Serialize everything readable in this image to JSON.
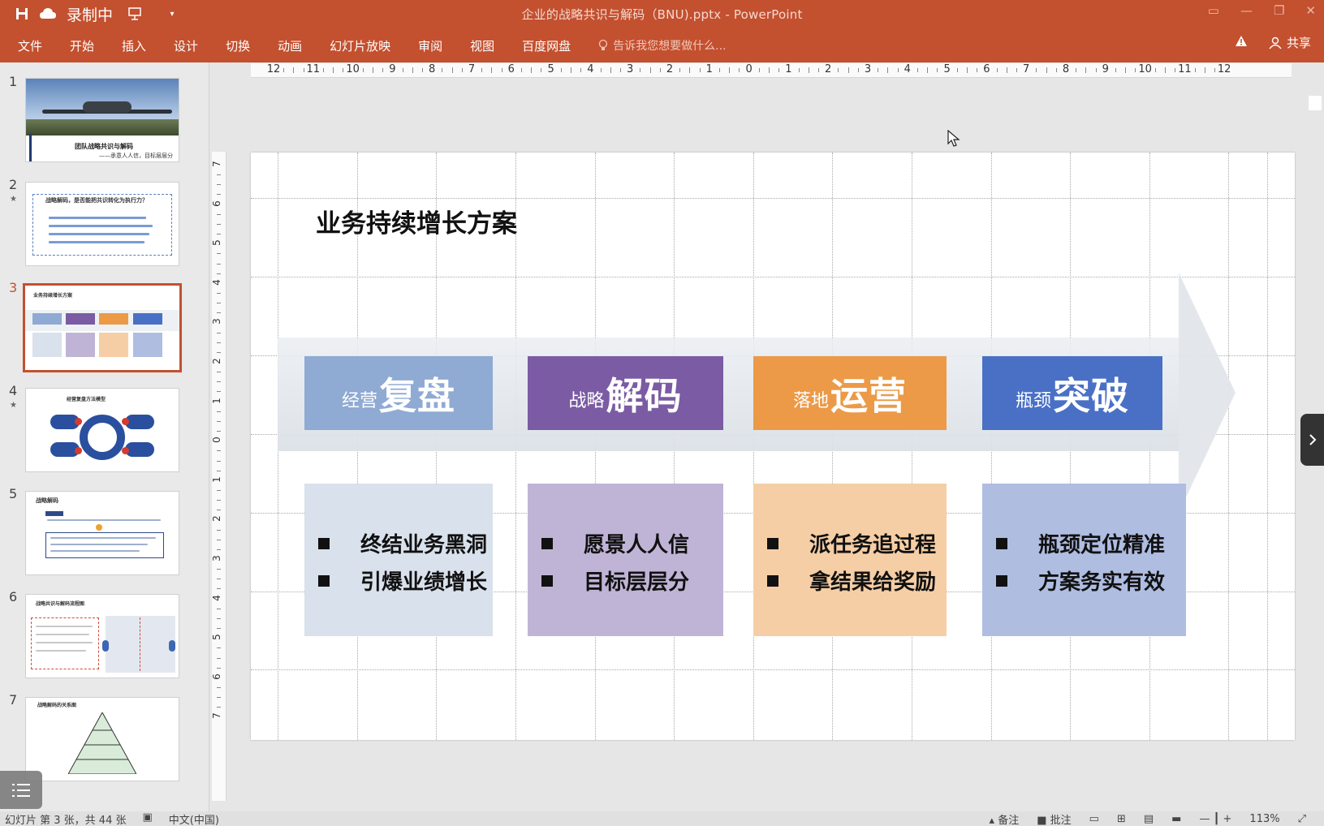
{
  "window": {
    "title": "企业的战略共识与解码（BNU).pptx - PowerPoint",
    "recording_label": "录制中"
  },
  "ribbon": {
    "tabs": [
      "文件",
      "开始",
      "插入",
      "设计",
      "切换",
      "动画",
      "幻灯片放映",
      "审阅",
      "视图",
      "百度网盘"
    ],
    "tell_me_placeholder": "告诉我您想要做什么...",
    "share_label": "共享"
  },
  "ruler": {
    "horizontal": [
      "12",
      "11",
      "10",
      "9",
      "8",
      "7",
      "6",
      "5",
      "4",
      "3",
      "2",
      "1",
      "0",
      "1",
      "2",
      "3",
      "4",
      "5",
      "6",
      "7",
      "8",
      "9",
      "10",
      "11",
      "12"
    ],
    "vertical": [
      "7",
      "6",
      "5",
      "4",
      "3",
      "2",
      "1",
      "0",
      "1",
      "2",
      "3",
      "4",
      "5",
      "6",
      "7"
    ]
  },
  "thumbnails": {
    "numbers": [
      "1",
      "2",
      "3",
      "4",
      "5",
      "6",
      "7"
    ],
    "active_index": 3,
    "slide1": {
      "title": "团队战略共识与解码",
      "subtitle": "——承意人人信，目标层层分"
    },
    "slide2": {
      "title": "战略解码，是否能把共识转化为执行力？"
    },
    "slide3": {
      "title": "业务持续增长方案",
      "heads": [
        "经营复盘",
        "战略解码",
        "落地运营",
        "瓶颈突破"
      ]
    },
    "slide4": {
      "title": "经营复盘方法模型"
    },
    "slide5": {
      "title": "战略解码"
    },
    "slide6": {
      "title": "战略共识与解码流程图"
    },
    "slide7": {
      "title": "战略解码的关系图"
    }
  },
  "slide": {
    "title": "业务持续增长方案",
    "columns": [
      {
        "small": "经营",
        "big": "复盘",
        "lines": [
          "终结业务黑洞",
          "引爆业绩增长"
        ],
        "head_color": "#8faad3",
        "body_color": "#d9e1ec"
      },
      {
        "small": "战略",
        "big": "解码",
        "lines": [
          "愿景人人信",
          "目标层层分"
        ],
        "head_color": "#7b5ba3",
        "body_color": "#c0b4d6"
      },
      {
        "small": "落地",
        "big": "运营",
        "lines": [
          "派任务追过程",
          "拿结果给奖励"
        ],
        "head_color": "#ec9a47",
        "body_color": "#f6cea5"
      },
      {
        "small": "瓶颈",
        "big": "突破",
        "lines": [
          "瓶颈定位精准",
          "方案务实有效"
        ],
        "head_color": "#4a70c6",
        "body_color": "#afbde1"
      }
    ]
  },
  "status": {
    "slide_info": "幻灯片 第 3 张，共 44 张",
    "language": "中文(中国)",
    "notes_label": "备注",
    "comments_label": "批注",
    "zoom": "113%"
  }
}
